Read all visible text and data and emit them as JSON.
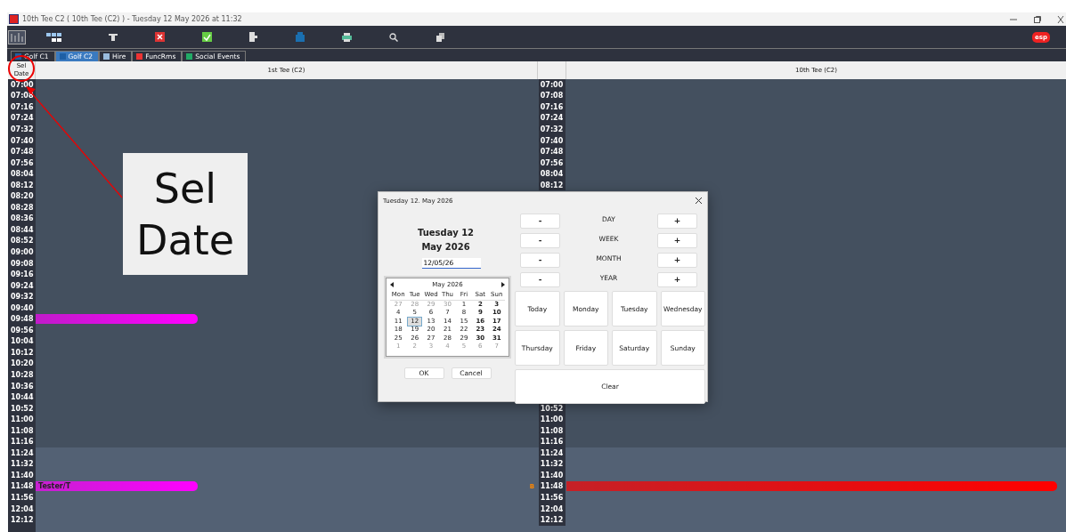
{
  "window": {
    "title": "10th Tee C2 ( 10th Tee (C2) )  - Tuesday 12 May 2026 at 11:32"
  },
  "tabs": [
    {
      "label": "Golf C1",
      "selected": false
    },
    {
      "label": "Golf C2",
      "selected": true
    },
    {
      "label": "Hire",
      "selected": false
    },
    {
      "label": "FuncRms",
      "selected": false
    },
    {
      "label": "Social Events",
      "selected": false
    }
  ],
  "grid": {
    "corner": "Sel\nDate",
    "columns": [
      "1st Tee (C2)",
      "10th Tee (C2)"
    ],
    "rows": [
      {
        "left_time": "07:00",
        "right_time": "07:00",
        "shaded": false
      },
      {
        "left_time": "07:08",
        "right_time": "07:08",
        "shaded": false
      },
      {
        "left_time": "07:16",
        "right_time": "07:16",
        "shaded": false
      },
      {
        "left_time": "07:24",
        "right_time": "07:24",
        "shaded": false
      },
      {
        "left_time": "07:32",
        "right_time": "07:32",
        "shaded": false
      },
      {
        "left_time": "07:40",
        "right_time": "07:40",
        "shaded": false
      },
      {
        "left_time": "07:48",
        "right_time": "07:48",
        "shaded": false
      },
      {
        "left_time": "07:56",
        "right_time": "07:56",
        "shaded": false
      },
      {
        "left_time": "08:04",
        "right_time": "08:04",
        "shaded": false
      },
      {
        "left_time": "08:12",
        "right_time": "08:12",
        "shaded": false
      },
      {
        "left_time": "08:20",
        "shaded": false
      },
      {
        "left_time": "08:28",
        "shaded": false
      },
      {
        "left_time": "08:36",
        "shaded": false
      },
      {
        "left_time": "08:44",
        "shaded": false
      },
      {
        "left_time": "08:52",
        "shaded": false
      },
      {
        "left_time": "09:00",
        "shaded": false
      },
      {
        "left_time": "09:08",
        "shaded": false
      },
      {
        "left_time": "09:16",
        "shaded": false
      },
      {
        "left_time": "09:24",
        "shaded": false
      },
      {
        "left_time": "09:32",
        "shaded": false
      },
      {
        "left_time": "09:40",
        "shaded": false
      },
      {
        "left_time": "09:48",
        "shaded": false,
        "left_booking": {
          "color": "#ff00ff"
        }
      },
      {
        "left_time": "09:56",
        "shaded": false
      },
      {
        "left_time": "10:04",
        "shaded": false
      },
      {
        "left_time": "10:12",
        "shaded": false
      },
      {
        "left_time": "10:20",
        "shaded": false
      },
      {
        "left_time": "10:28",
        "shaded": false
      },
      {
        "left_time": "10:36",
        "shaded": false
      },
      {
        "left_time": "10:44",
        "shaded": false
      },
      {
        "left_time": "10:52",
        "right_time": "10:52",
        "shaded": false
      },
      {
        "left_time": "11:00",
        "right_time": "11:00",
        "shaded": false
      },
      {
        "left_time": "11:08",
        "right_time": "11:08",
        "shaded": false
      },
      {
        "left_time": "11:16",
        "right_time": "11:16",
        "shaded": false
      },
      {
        "left_time": "11:24",
        "right_time": "11:24",
        "shaded": true
      },
      {
        "left_time": "11:32",
        "right_time": "11:32",
        "shaded": true
      },
      {
        "left_time": "11:40",
        "right_time": "11:40",
        "shaded": true
      },
      {
        "left_time": "11:48",
        "right_time": "11:48",
        "shaded": true,
        "left_booking": {
          "color": "#ff00ff",
          "label": "Tester/T"
        },
        "right_marker": "B",
        "right_booking": {
          "color": "#ff0000"
        }
      },
      {
        "left_time": "11:56",
        "right_time": "11:56",
        "shaded": true
      },
      {
        "left_time": "12:04",
        "right_time": "12:04",
        "shaded": true
      },
      {
        "left_time": "12:12",
        "right_time": "12:12",
        "shaded": true
      },
      {
        "shaded": true
      }
    ]
  },
  "annotation": {
    "inset_lines": [
      "Sel",
      "Date"
    ]
  },
  "dialog": {
    "title": "Tuesday 12. May 2026",
    "date_lines": [
      "Tuesday 12",
      "May 2026"
    ],
    "date_value": "12/05/26",
    "calendar": {
      "month": "May 2026",
      "weekdays": [
        "Mon",
        "Tue",
        "Wed",
        "Thu",
        "Fri",
        "Sat",
        "Sun"
      ],
      "weeks": [
        [
          {
            "d": "27",
            "muted": true,
            "selected": false
          },
          {
            "d": "28",
            "muted": true,
            "selected": false
          },
          {
            "d": "29",
            "muted": true,
            "selected": false
          },
          {
            "d": "30",
            "muted": true,
            "selected": false
          },
          {
            "d": "1",
            "muted": false,
            "selected": false
          },
          {
            "d": "2",
            "muted": false,
            "selected": false
          },
          {
            "d": "3",
            "muted": false,
            "selected": false
          }
        ],
        [
          {
            "d": "4",
            "muted": false,
            "selected": false
          },
          {
            "d": "5",
            "muted": false,
            "selected": false
          },
          {
            "d": "6",
            "muted": false,
            "selected": false
          },
          {
            "d": "7",
            "muted": false,
            "selected": false
          },
          {
            "d": "8",
            "muted": false,
            "selected": false
          },
          {
            "d": "9",
            "muted": false,
            "selected": false
          },
          {
            "d": "10",
            "muted": false,
            "selected": false
          }
        ],
        [
          {
            "d": "11",
            "muted": false,
            "selected": false
          },
          {
            "d": "12",
            "muted": false,
            "selected": true
          },
          {
            "d": "13",
            "muted": false,
            "selected": false
          },
          {
            "d": "14",
            "muted": false,
            "selected": false
          },
          {
            "d": "15",
            "muted": false,
            "selected": false
          },
          {
            "d": "16",
            "muted": false,
            "selected": false
          },
          {
            "d": "17",
            "muted": false,
            "selected": false
          }
        ],
        [
          {
            "d": "18",
            "muted": false,
            "selected": false
          },
          {
            "d": "19",
            "muted": false,
            "selected": false
          },
          {
            "d": "20",
            "muted": false,
            "selected": false
          },
          {
            "d": "21",
            "muted": false,
            "selected": false
          },
          {
            "d": "22",
            "muted": false,
            "selected": false
          },
          {
            "d": "23",
            "muted": false,
            "selected": false
          },
          {
            "d": "24",
            "muted": false,
            "selected": false
          }
        ],
        [
          {
            "d": "25",
            "muted": false,
            "selected": false
          },
          {
            "d": "26",
            "muted": false,
            "selected": false
          },
          {
            "d": "27",
            "muted": false,
            "selected": false
          },
          {
            "d": "28",
            "muted": false,
            "selected": false
          },
          {
            "d": "29",
            "muted": false,
            "selected": false
          },
          {
            "d": "30",
            "muted": false,
            "selected": false
          },
          {
            "d": "31",
            "muted": false,
            "selected": false
          }
        ],
        [
          {
            "d": "1",
            "muted": true,
            "selected": false
          },
          {
            "d": "2",
            "muted": true,
            "selected": false
          },
          {
            "d": "3",
            "muted": true,
            "selected": false
          },
          {
            "d": "4",
            "muted": true,
            "selected": false
          },
          {
            "d": "5",
            "muted": true,
            "selected": false
          },
          {
            "d": "6",
            "muted": true,
            "selected": false
          },
          {
            "d": "7",
            "muted": true,
            "selected": false
          }
        ]
      ]
    },
    "ok": "OK",
    "cancel": "Cancel",
    "steps": [
      {
        "minus": "-",
        "label": "DAY",
        "plus": "+"
      },
      {
        "minus": "-",
        "label": "WEEK",
        "plus": "+"
      },
      {
        "minus": "-",
        "label": "MONTH",
        "plus": "+"
      },
      {
        "minus": "-",
        "label": "YEAR",
        "plus": "+"
      }
    ],
    "quick": [
      "Today",
      "Monday",
      "Tuesday",
      "Wednesday",
      "Thursday",
      "Friday",
      "Saturday",
      "Sunday"
    ],
    "clear": "Clear"
  },
  "logo": "esp"
}
